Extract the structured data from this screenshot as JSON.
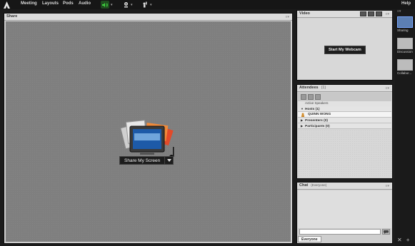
{
  "menubar": {
    "items": [
      "Meeting",
      "Layouts",
      "Pods",
      "Audio"
    ],
    "help": "Help",
    "icons": [
      "adobe-logo",
      "speaker-icon",
      "webcam-icon",
      "raise-hand-icon"
    ]
  },
  "share_pod": {
    "title": "Share",
    "button_label": "Share My Screen"
  },
  "video_pod": {
    "title": "Video",
    "button_label": "Start My Webcam"
  },
  "attendees_pod": {
    "title": "Attendees",
    "count": "(1)",
    "active_speakers": "Active Speakers",
    "groups": [
      {
        "label": "Hosts (1)",
        "expanded": true
      },
      {
        "label": "Presenters (0)",
        "expanded": false
      },
      {
        "label": "Participants (0)",
        "expanded": false
      }
    ],
    "host_name": "QUINN  WONG"
  },
  "chat_pod": {
    "title": "Chat",
    "subtitle": "(Everyone)",
    "tab": "Everyone"
  },
  "layouts_rail": {
    "items": [
      {
        "label": "Sharing",
        "selected": true
      },
      {
        "label": "Discussion",
        "selected": false
      },
      {
        "label": "Collabor...",
        "selected": false
      }
    ]
  },
  "colors": {
    "accent_green": "#3fd13f",
    "selected_layout": "#5c7fb3"
  }
}
